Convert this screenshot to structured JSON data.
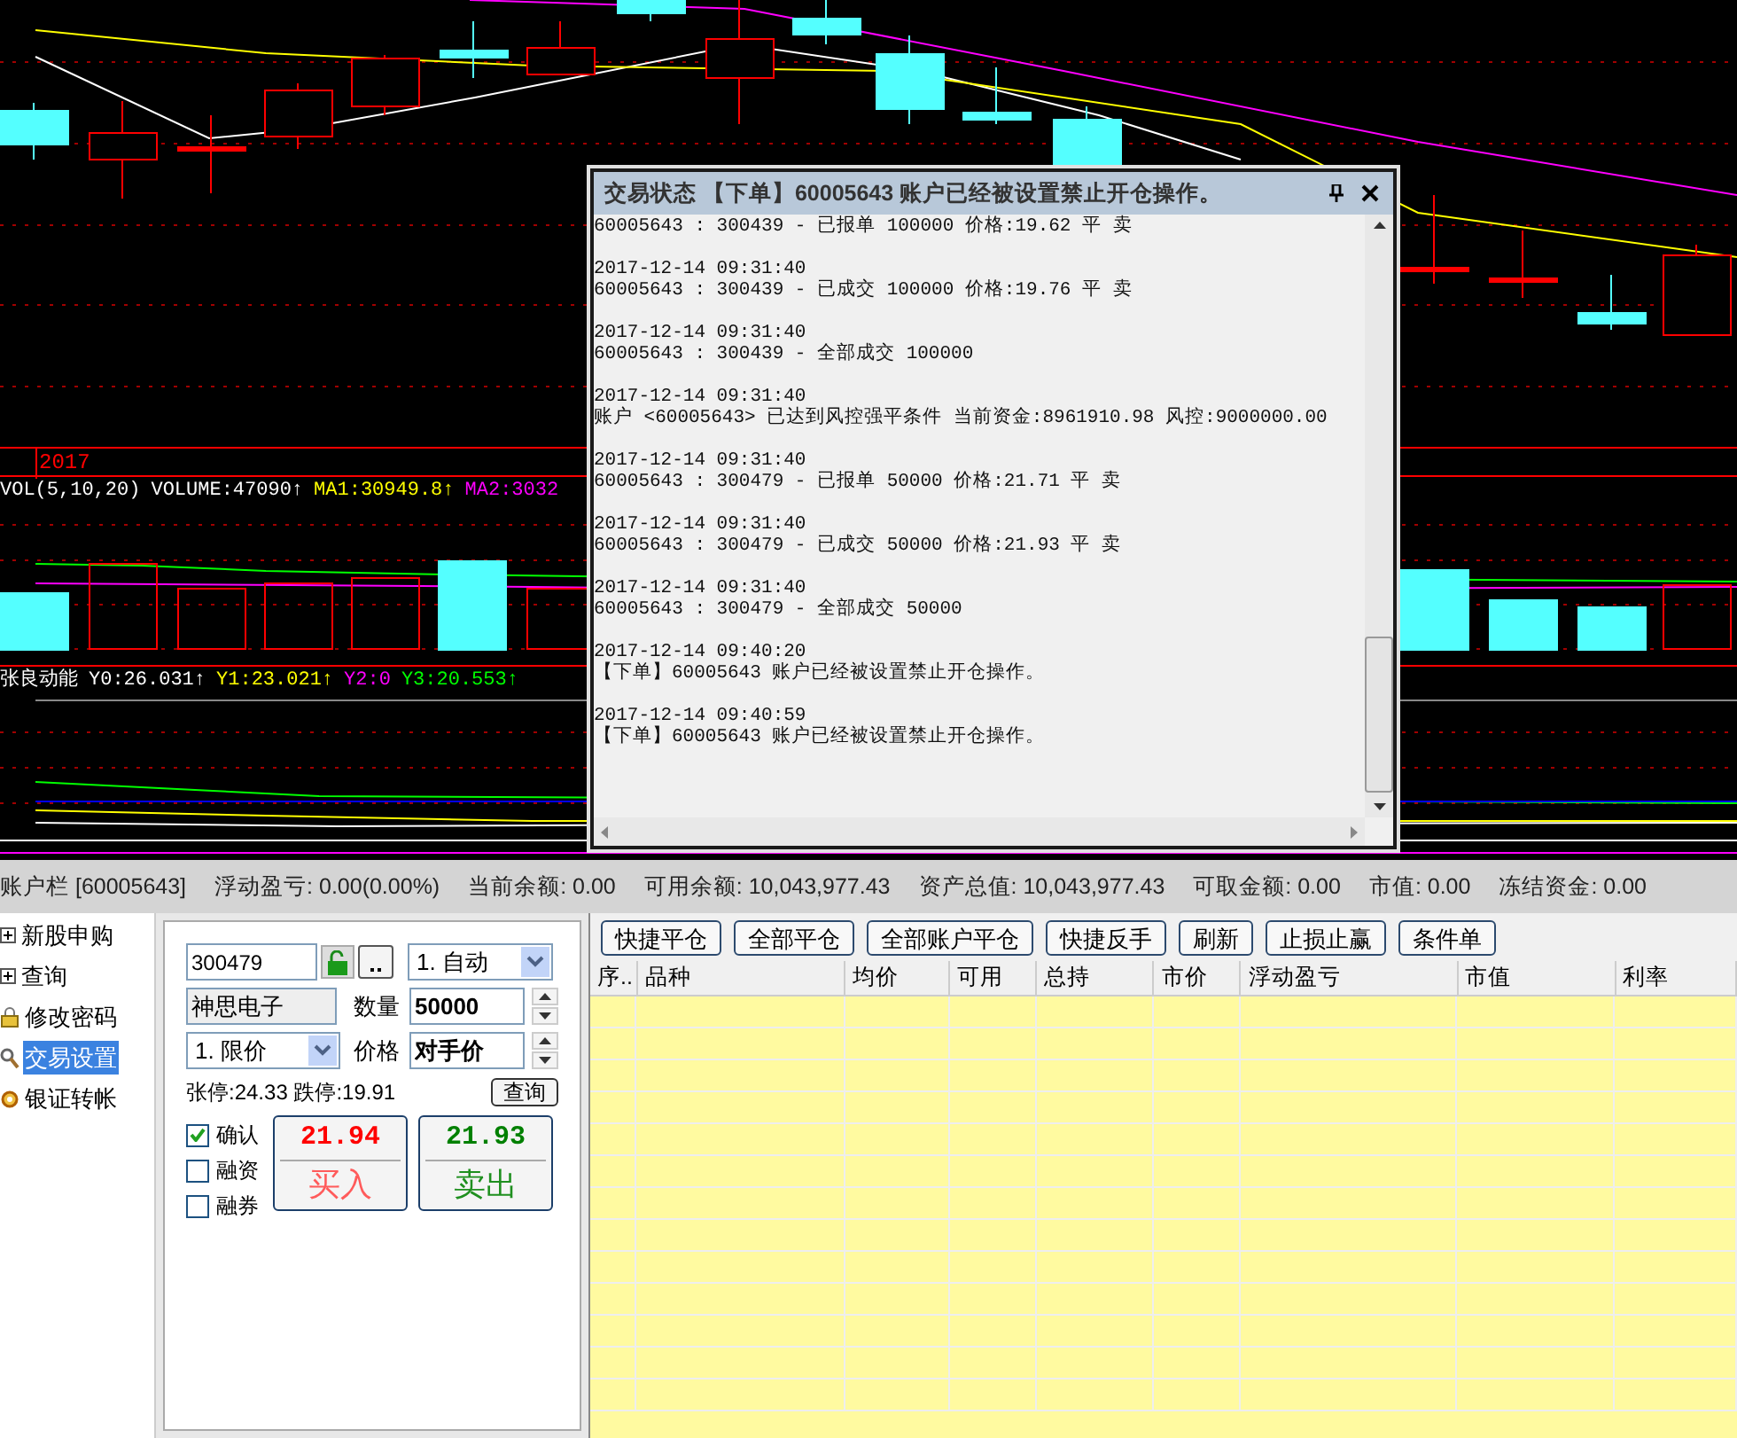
{
  "chart": {
    "axis_label": "2017",
    "volume_legend": [
      {
        "text": "VOL(5,10,20)",
        "color": "#ffffff"
      },
      {
        "text": "VOLUME:47090↑",
        "color": "#ffffff"
      },
      {
        "text": "MA1:30949.8↑",
        "color": "#ffff00"
      },
      {
        "text": "MA2:3032",
        "color": "#ff00ff"
      }
    ],
    "indicator_legend": [
      {
        "text": "张良动能",
        "color": "#ffffff"
      },
      {
        "text": "Y0:26.031↑",
        "color": "#ffffff"
      },
      {
        "text": "Y1:23.021↑",
        "color": "#ffff00"
      },
      {
        "text": "Y2:0",
        "color": "#ff00ff"
      },
      {
        "text": "Y3:20.553↑",
        "color": "#00ff00"
      }
    ]
  },
  "dialog": {
    "title": "交易状态 【下单】60005643 账户已经被设置禁止开仓操作。",
    "log": [
      {
        "message": "60005643 : 300439 - 已报单 100000 价格:19.62 平 卖"
      },
      {
        "time": "2017-12-14 09:31:40",
        "message": "60005643 : 300439 - 已成交 100000 价格:19.76 平 卖"
      },
      {
        "time": "2017-12-14 09:31:40",
        "message": "60005643 : 300439 - 全部成交 100000"
      },
      {
        "time": "2017-12-14 09:31:40",
        "message": "账户 <60005643> 已达到风控强平条件 当前资金:8961910.98 风控:9000000.00"
      },
      {
        "time": "2017-12-14 09:31:40",
        "message": "60005643 : 300479 - 已报单 50000 价格:21.71 平 卖"
      },
      {
        "time": "2017-12-14 09:31:40",
        "message": "60005643 : 300479 - 已成交 50000 价格:21.93 平 卖"
      },
      {
        "time": "2017-12-14 09:31:40",
        "message": "60005643 : 300479 - 全部成交 50000"
      },
      {
        "time": "2017-12-14 09:40:20",
        "message": "【下单】60005643 账户已经被设置禁止开仓操作。"
      },
      {
        "time": "2017-12-14 09:40:59",
        "message": "【下单】60005643 账户已经被设置禁止开仓操作。"
      }
    ]
  },
  "account_bar": [
    "账户栏 [60005643]",
    "浮动盈亏: 0.00(0.00%)",
    "当前余额: 0.00",
    "可用余额: 10,043,977.43",
    "资产总值: 10,043,977.43",
    "可取金额: 0.00",
    "市值: 0.00",
    "冻结资金: 0.00"
  ],
  "tree": [
    {
      "label": "新股申购",
      "kind": "folder",
      "expanded": false,
      "selected": false
    },
    {
      "label": "查询",
      "kind": "folder",
      "expanded": false,
      "selected": false
    },
    {
      "label": "修改密码",
      "kind": "lock",
      "selected": false
    },
    {
      "label": "交易设置",
      "kind": "settings",
      "selected": true
    },
    {
      "label": "银证转帐",
      "kind": "transfer",
      "selected": false
    }
  ],
  "order": {
    "code": "300479",
    "mode": "1. 自动",
    "name": "神思电子",
    "quantity_label": "数量",
    "quantity": "50000",
    "price_type": "1. 限价",
    "price_label": "价格",
    "price": "对手价",
    "limits": "张停:24.33 跌停:19.91",
    "query_button": "查询",
    "options": [
      {
        "label": "确认",
        "checked": true
      },
      {
        "label": "融资",
        "checked": false
      },
      {
        "label": "融券",
        "checked": false
      }
    ],
    "buy": {
      "price": "21.94",
      "label": "买入"
    },
    "sell": {
      "price": "21.93",
      "label": "卖出"
    }
  },
  "toolbar": [
    "快捷平仓",
    "全部平仓",
    "全部账户平仓",
    "快捷反手",
    "刷新",
    "止损止赢",
    "条件单"
  ],
  "table": {
    "columns": [
      "序..",
      "品种",
      "均价",
      "可用",
      "总持",
      "市价",
      "浮动盈亏",
      "市值",
      "利率"
    ]
  }
}
